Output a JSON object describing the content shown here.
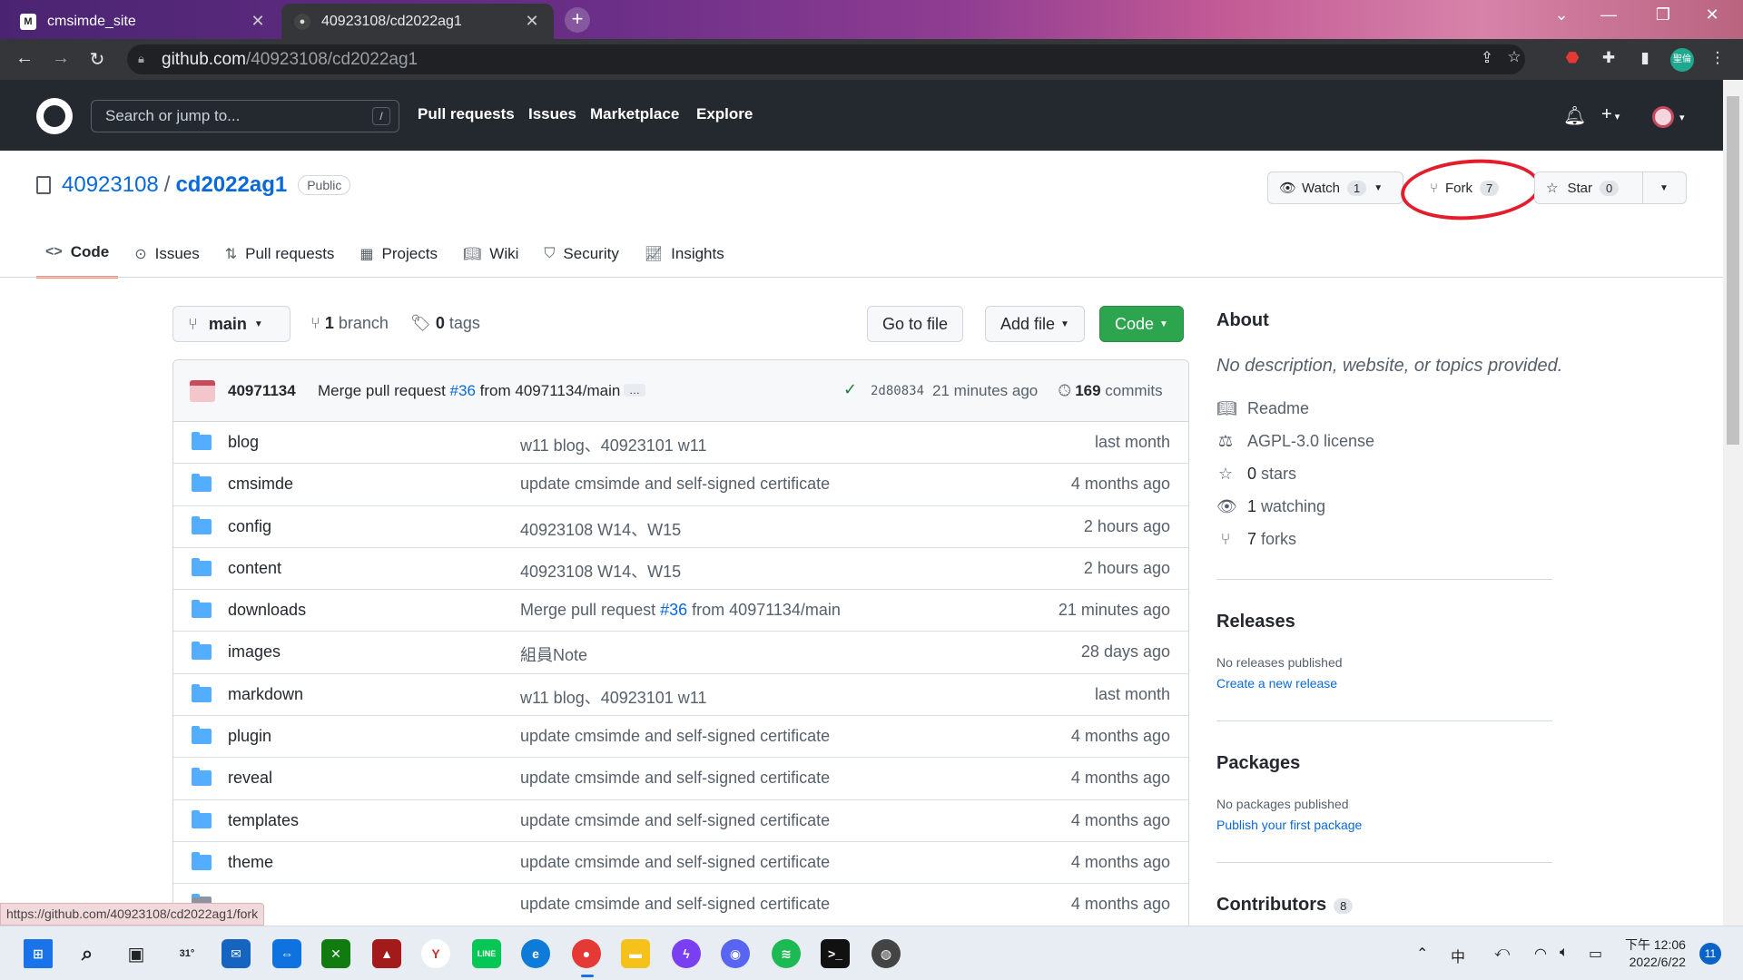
{
  "browser": {
    "tabs": [
      {
        "title": "cmsimde_site",
        "active": false
      },
      {
        "title": "40923108/cd2022ag1",
        "active": true
      }
    ],
    "url_host": "github.com",
    "url_path": "/40923108/cd2022ag1",
    "profile_label": "聖倫"
  },
  "gh": {
    "search_placeholder": "Search or jump to...",
    "search_shortcut": "/",
    "nav": [
      "Pull requests",
      "Issues",
      "Marketplace",
      "Explore"
    ]
  },
  "repo": {
    "owner": "40923108",
    "name": "cd2022ag1",
    "visibility": "Public",
    "watch_label": "Watch",
    "watch_count": "1",
    "fork_label": "Fork",
    "fork_count": "7",
    "star_label": "Star",
    "star_count": "0",
    "tabs": [
      {
        "label": "Code",
        "icon": "code-icon",
        "selected": true
      },
      {
        "label": "Issues",
        "icon": "issue-icon"
      },
      {
        "label": "Pull requests",
        "icon": "pull-request-icon"
      },
      {
        "label": "Projects",
        "icon": "project-icon"
      },
      {
        "label": "Wiki",
        "icon": "book-icon"
      },
      {
        "label": "Security",
        "icon": "shield-icon"
      },
      {
        "label": "Insights",
        "icon": "graph-icon"
      }
    ]
  },
  "files": {
    "branch": "main",
    "branch_count": "1",
    "branch_word": "branch",
    "tag_count": "0",
    "tag_word": "tags",
    "go_to_file": "Go to file",
    "add_file": "Add file",
    "code_btn": "Code",
    "latest_commit": {
      "author": "40971134",
      "msg_pre": "Merge pull request",
      "msg_link": "#36",
      "msg_post": "from 40971134/main",
      "more": "…",
      "sha": "2d80834",
      "time": "21 minutes ago",
      "commit_count": "169",
      "commit_word": "commits"
    },
    "rows": [
      {
        "name": "blog",
        "msg": "w11 blog、40923101 w11",
        "time": "last month"
      },
      {
        "name": "cmsimde",
        "msg": "update cmsimde and self-signed certificate",
        "time": "4 months ago"
      },
      {
        "name": "config",
        "msg": "40923108 W14、W15",
        "time": "2 hours ago"
      },
      {
        "name": "content",
        "msg": "40923108 W14、W15",
        "time": "2 hours ago"
      },
      {
        "name": "downloads",
        "msg_pre": "Merge pull request",
        "msg_link": "#36",
        "msg_post": "from 40971134/main",
        "time": "21 minutes ago"
      },
      {
        "name": "images",
        "msg": "組員Note",
        "time": "28 days ago"
      },
      {
        "name": "markdown",
        "msg": "w11 blog、40923101 w11",
        "time": "last month"
      },
      {
        "name": "plugin",
        "msg": "update cmsimde and self-signed certificate",
        "time": "4 months ago"
      },
      {
        "name": "reveal",
        "msg": "update cmsimde and self-signed certificate",
        "time": "4 months ago"
      },
      {
        "name": "templates",
        "msg": "update cmsimde and self-signed certificate",
        "time": "4 months ago"
      },
      {
        "name": "theme",
        "msg": "update cmsimde and self-signed certificate",
        "time": "4 months ago"
      },
      {
        "name": "",
        "msg": "update cmsimde and self-signed certificate",
        "time": "4 months ago"
      }
    ]
  },
  "sidebar": {
    "about": "About",
    "description": "No description, website, or topics provided.",
    "readme": "Readme",
    "license": "AGPL-3.0 license",
    "stars_n": "0",
    "stars_w": "stars",
    "watching_n": "1",
    "watching_w": "watching",
    "forks_n": "7",
    "forks_w": "forks",
    "releases": "Releases",
    "no_releases": "No releases published",
    "create_release": "Create a new release",
    "packages": "Packages",
    "no_packages": "No packages published",
    "publish_package": "Publish your first package",
    "contributors": "Contributors",
    "contributors_count": "8"
  },
  "status_url": "https://github.com/40923108/cd2022ag1/fork",
  "taskbar": {
    "weather": "31°",
    "ime": "中",
    "time": "下午 12:06",
    "date": "2022/6/22",
    "notifications": "11"
  },
  "colors": {
    "accent": "#0969da",
    "green": "#2da44e",
    "annotation": "#e31d2b"
  }
}
